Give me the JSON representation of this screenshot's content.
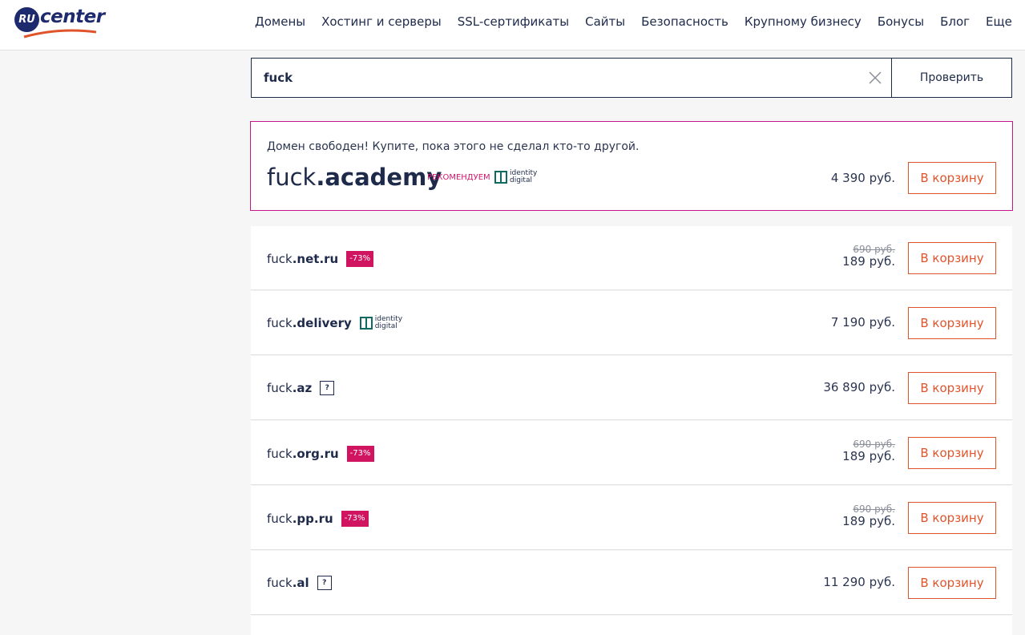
{
  "logo": {
    "ru": "RU",
    "center": "center"
  },
  "nav": [
    "Домены",
    "Хостинг и серверы",
    "SSL-сертификаты",
    "Сайты",
    "Безопасность",
    "Крупному бизнесу",
    "Бонусы",
    "Блог",
    "Еще"
  ],
  "search": {
    "value": "fuck",
    "button": "Проверить"
  },
  "featured": {
    "message": "Домен свободен! Купите, пока этого не сделал кто-то другой.",
    "name": "fuck",
    "tld": ".academy",
    "recommend": "РЕКОМЕНДУЕМ",
    "registry_line1": "identity",
    "registry_line2": "digital",
    "price": "4 390 руб.",
    "cart": "В корзину"
  },
  "rows": [
    {
      "name": "fuck",
      "tld": ".net.ru",
      "badge": "-73%",
      "old_price": "690 руб.",
      "price": "189 руб.",
      "cart": "В корзину"
    },
    {
      "name": "fuck",
      "tld": ".delivery",
      "registry_line1": "identity",
      "registry_line2": "digital",
      "price": "7 190 руб.",
      "cart": "В корзину"
    },
    {
      "name": "fuck",
      "tld": ".az",
      "help": "?",
      "price": "36 890 руб.",
      "cart": "В корзину"
    },
    {
      "name": "fuck",
      "tld": ".org.ru",
      "badge": "-73%",
      "old_price": "690 руб.",
      "price": "189 руб.",
      "cart": "В корзину"
    },
    {
      "name": "fuck",
      "tld": ".pp.ru",
      "badge": "-73%",
      "old_price": "690 руб.",
      "price": "189 руб.",
      "cart": "В корзину"
    },
    {
      "name": "fuck",
      "tld": ".al",
      "help": "?",
      "price": "11 290 руб.",
      "cart": "В корзину"
    }
  ],
  "colors": {
    "accent": "#e0542c",
    "brand": "#1e2a6e",
    "badge": "#d0145f",
    "featured_border": "#c2188b"
  }
}
